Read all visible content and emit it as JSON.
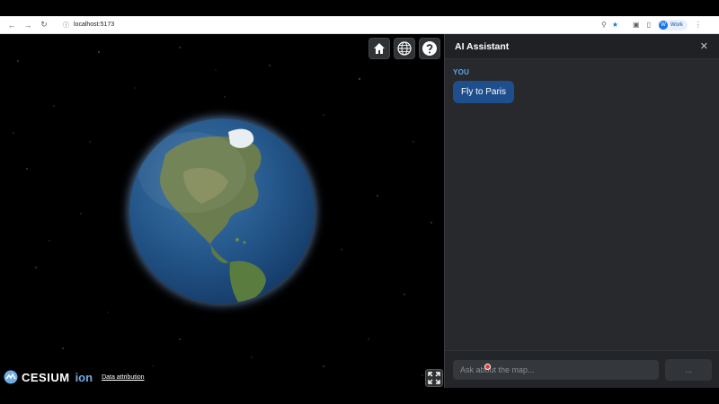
{
  "browser": {
    "url": "localhost:5173",
    "profile_initial": "W",
    "profile_name": "Work"
  },
  "viewer": {
    "logo_text": "CESIUM",
    "logo_suffix": "ion",
    "attribution": "Data attribution"
  },
  "assistant": {
    "title": "AI Assistant",
    "messages": [
      {
        "sender": "YOU",
        "text": "Fly to Paris"
      }
    ],
    "input_placeholder": "Ask about the map...",
    "send_label": "..."
  },
  "colors": {
    "accent": "#5aa9f0",
    "bubble": "#1e4f8c",
    "panel_bg": "#27292d"
  }
}
